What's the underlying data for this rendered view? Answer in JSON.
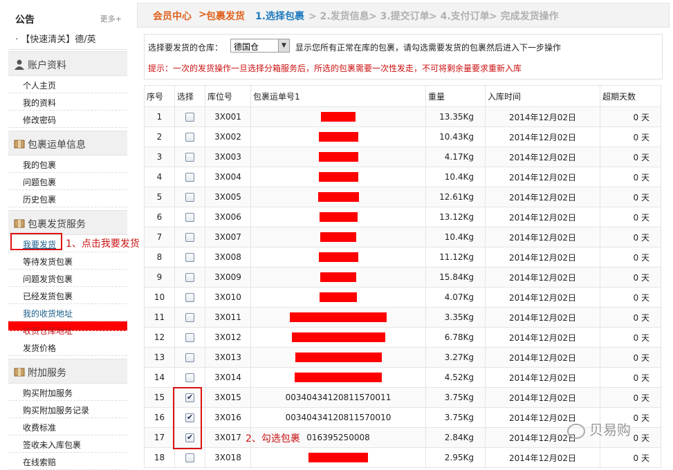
{
  "sidebar": {
    "notice_title": "公告",
    "more": "更多+",
    "notice_item": "【快速清关】德/英",
    "sections": [
      {
        "title": "账户资料",
        "items": [
          "个人主页",
          "我的资料",
          "修改密码"
        ]
      },
      {
        "title": "包裹运单信息",
        "items": [
          "我的包裹",
          "问题包裹",
          "历史包裹"
        ]
      },
      {
        "title": "包裹发货服务",
        "items": [
          "我要发货",
          "等待发货包裹",
          "问题发货包裹",
          "已经发货包裹",
          "我的收货地址",
          "收货仓库地址",
          "发货价格"
        ]
      },
      {
        "title": "附加服务",
        "items": [
          "购买附加服务",
          "购买附加服务记录",
          "收费标准",
          "签收未入库包裹",
          "在线索赔"
        ]
      }
    ]
  },
  "annotations": {
    "step1": "1、点击我要发货",
    "step2": "2、勾选包裹"
  },
  "breadcrumb": {
    "home": "会员中心",
    "sep": ">",
    "page": "包裹发货",
    "s1": "1.选择包裹",
    "s2": "> 2.发货信息",
    "s3": "> 3.提交订单",
    "s4": "> 4.支付订单",
    "s5": "> 完成发货操作"
  },
  "filter": {
    "label": "选择要发货的仓库：",
    "selected": "德国仓",
    "desc": "显示您所有正常在库的包裹，请勾选需要发货的包裹然后进入下一步操作",
    "tip": "提示：一次的发货操作一旦选择分箱服务后，所选的包裹需要一次性发走，不可将剩余量要求重新入库"
  },
  "table": {
    "headers": [
      "序号",
      "选择",
      "库位号",
      "包裹运单号1",
      "重量",
      "入库时间",
      "超期天数"
    ],
    "rows": [
      {
        "no": "1",
        "checked": false,
        "loc": "3X001",
        "tracking": "",
        "weight": "13.35Kg",
        "date": "2014年12月02日",
        "days": "0 天"
      },
      {
        "no": "2",
        "checked": false,
        "loc": "3X002",
        "tracking": "",
        "weight": "10.43Kg",
        "date": "2014年12月02日",
        "days": "0 天"
      },
      {
        "no": "3",
        "checked": false,
        "loc": "3X003",
        "tracking": "",
        "weight": "4.17Kg",
        "date": "2014年12月02日",
        "days": "0 天"
      },
      {
        "no": "4",
        "checked": false,
        "loc": "3X004",
        "tracking": "",
        "weight": "10.4Kg",
        "date": "2014年12月02日",
        "days": "0 天"
      },
      {
        "no": "5",
        "checked": false,
        "loc": "3X005",
        "tracking": "",
        "weight": "12.61Kg",
        "date": "2014年12月02日",
        "days": "0 天"
      },
      {
        "no": "6",
        "checked": false,
        "loc": "3X006",
        "tracking": "",
        "weight": "13.12Kg",
        "date": "2014年12月02日",
        "days": "0 天"
      },
      {
        "no": "7",
        "checked": false,
        "loc": "3X007",
        "tracking": "",
        "weight": "10.4Kg",
        "date": "2014年12月02日",
        "days": "0 天"
      },
      {
        "no": "8",
        "checked": false,
        "loc": "3X008",
        "tracking": "",
        "weight": "11.12Kg",
        "date": "2014年12月02日",
        "days": "0 天"
      },
      {
        "no": "9",
        "checked": false,
        "loc": "3X009",
        "tracking": "",
        "weight": "15.84Kg",
        "date": "2014年12月02日",
        "days": "0 天"
      },
      {
        "no": "10",
        "checked": false,
        "loc": "3X010",
        "tracking": "",
        "weight": "4.07Kg",
        "date": "2014年12月02日",
        "days": "0 天"
      },
      {
        "no": "11",
        "checked": false,
        "loc": "3X011",
        "tracking": "",
        "weight": "3.35Kg",
        "date": "2014年12月02日",
        "days": "0 天"
      },
      {
        "no": "12",
        "checked": false,
        "loc": "3X012",
        "tracking": "",
        "weight": "6.78Kg",
        "date": "2014年12月02日",
        "days": "0 天"
      },
      {
        "no": "13",
        "checked": false,
        "loc": "3X013",
        "tracking": "",
        "weight": "3.27Kg",
        "date": "2014年12月02日",
        "days": "0 天"
      },
      {
        "no": "14",
        "checked": false,
        "loc": "3X014",
        "tracking": "",
        "weight": "4.52Kg",
        "date": "2014年12月02日",
        "days": "0 天"
      },
      {
        "no": "15",
        "checked": true,
        "loc": "3X015",
        "tracking": "00340434120811570011",
        "weight": "3.75Kg",
        "date": "2014年12月02日",
        "days": "0 天"
      },
      {
        "no": "16",
        "checked": true,
        "loc": "3X016",
        "tracking": "00340434120811570010",
        "weight": "3.75Kg",
        "date": "2014年12月02日",
        "days": "0 天"
      },
      {
        "no": "17",
        "checked": true,
        "loc": "3X017",
        "tracking": "016395250008",
        "weight": "2.84Kg",
        "date": "2014年12月02日",
        "days": "0 天"
      },
      {
        "no": "18",
        "checked": false,
        "loc": "3X018",
        "tracking": "",
        "weight": "2.95Kg",
        "date": "2014年12月02日",
        "days": "0 天"
      }
    ]
  },
  "watermark": "贝易购",
  "colors": {
    "redaction": "#ff0000",
    "breadcrumb": "#e0621e",
    "step_active": "#1f7cc0",
    "step_inactive": "#b0b0b0"
  }
}
